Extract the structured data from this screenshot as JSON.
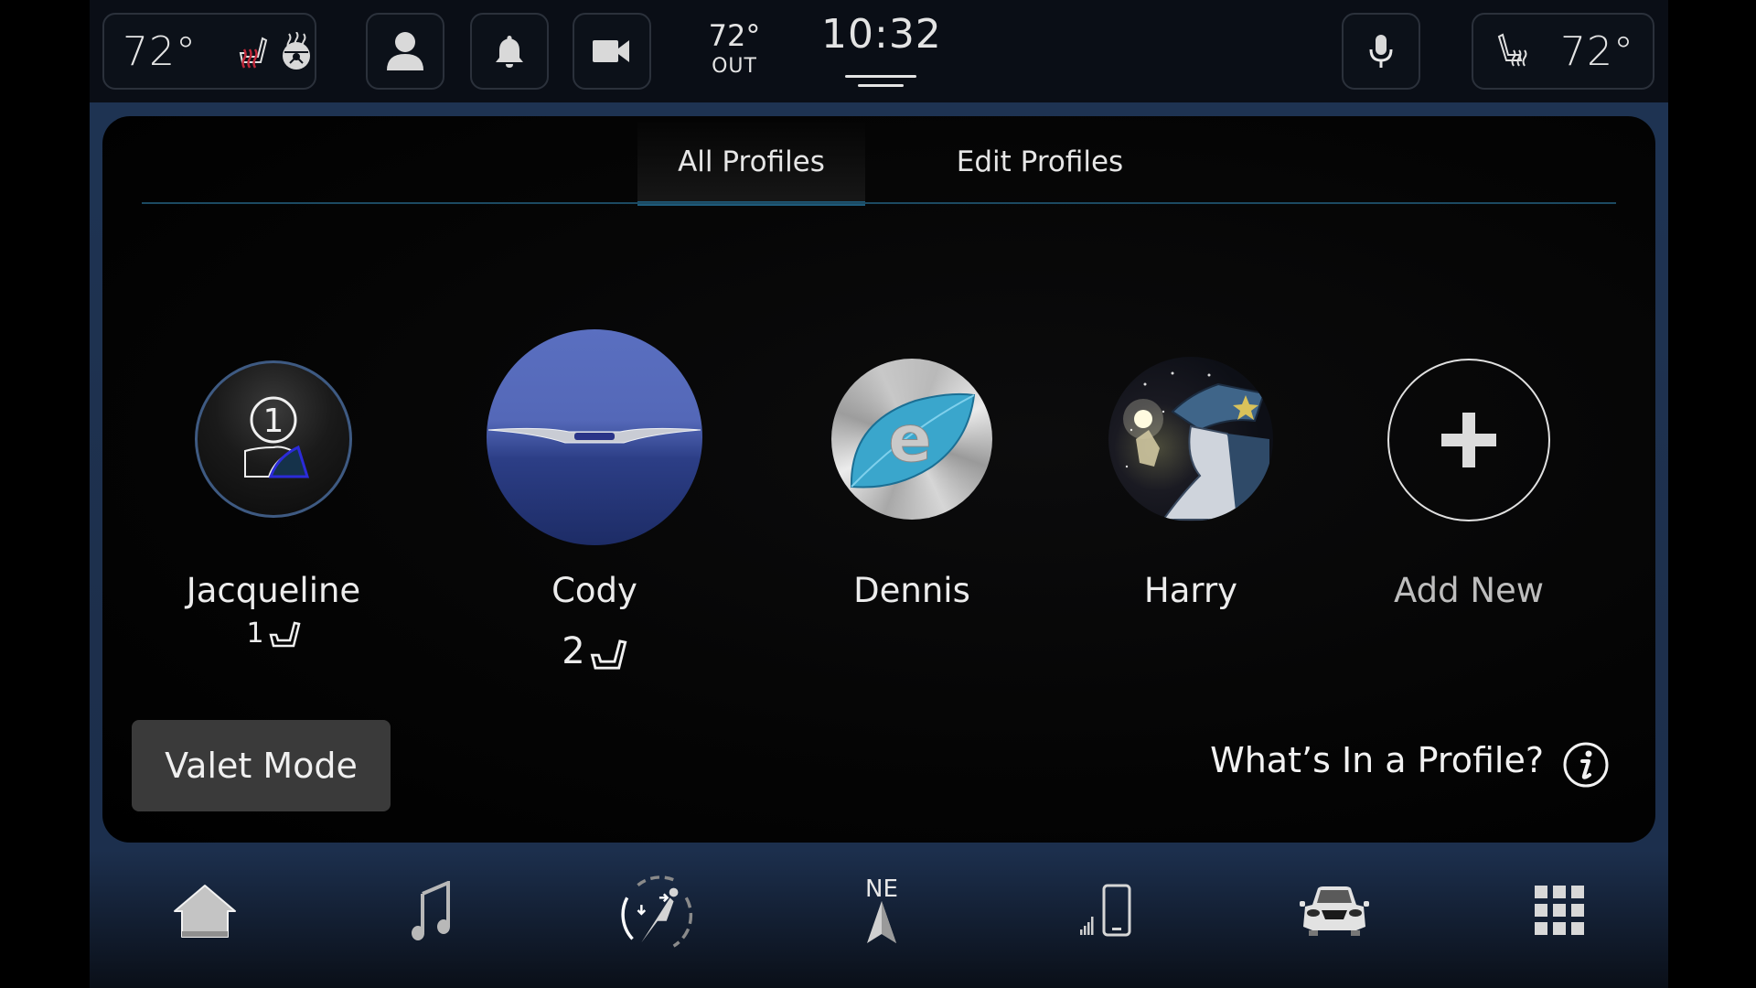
{
  "top_bar": {
    "driver_temp": "72°",
    "passenger_temp": "72°",
    "outside_temp": "72°",
    "outside_label": "OUT",
    "clock": "10:32",
    "icons": {
      "driver_seat_heat": "heated-seat-icon",
      "steering_heat": "heated-steering-wheel-icon",
      "profile": "user-icon",
      "notifications": "bell-icon",
      "camera": "camera-icon",
      "voice": "microphone-icon",
      "passenger_seat_heat": "heated-seat-icon"
    },
    "colors": {
      "seat_heat_active": "#c0283a"
    }
  },
  "tabs": [
    {
      "label": "All Profiles",
      "active": true
    },
    {
      "label": "Edit Profiles",
      "active": false
    }
  ],
  "profiles": [
    {
      "name": "Jacqueline",
      "seat_memory": "1",
      "avatar": "numbered-user-avatar",
      "avatar_number": "1"
    },
    {
      "name": "Cody",
      "seat_memory": "2",
      "avatar": "brand-wings-avatar"
    },
    {
      "name": "Dennis",
      "seat_memory": "",
      "avatar": "eco-leaf-avatar",
      "avatar_letter": "e"
    },
    {
      "name": "Harry",
      "seat_memory": "",
      "avatar": "wizard-avatar"
    },
    {
      "name": "Add New",
      "avatar": "plus-icon"
    }
  ],
  "valet_button": "Valet Mode",
  "whats_in_profile": "What’s In a Profile?",
  "bottom_nav": {
    "items": [
      {
        "id": "home",
        "icon": "home-icon"
      },
      {
        "id": "media",
        "icon": "music-note-icon"
      },
      {
        "id": "comfort",
        "icon": "seat-comfort-icon"
      },
      {
        "id": "navigation",
        "icon": "compass-arrow-icon",
        "heading": "NE"
      },
      {
        "id": "phone",
        "icon": "phone-signal-icon"
      },
      {
        "id": "vehicle",
        "icon": "car-icon"
      },
      {
        "id": "apps",
        "icon": "apps-grid-icon"
      }
    ]
  },
  "colors": {
    "accent_line": "#1e5a7a",
    "panel_border": "#1e3352",
    "valet_bg": "#3a3a3a"
  }
}
